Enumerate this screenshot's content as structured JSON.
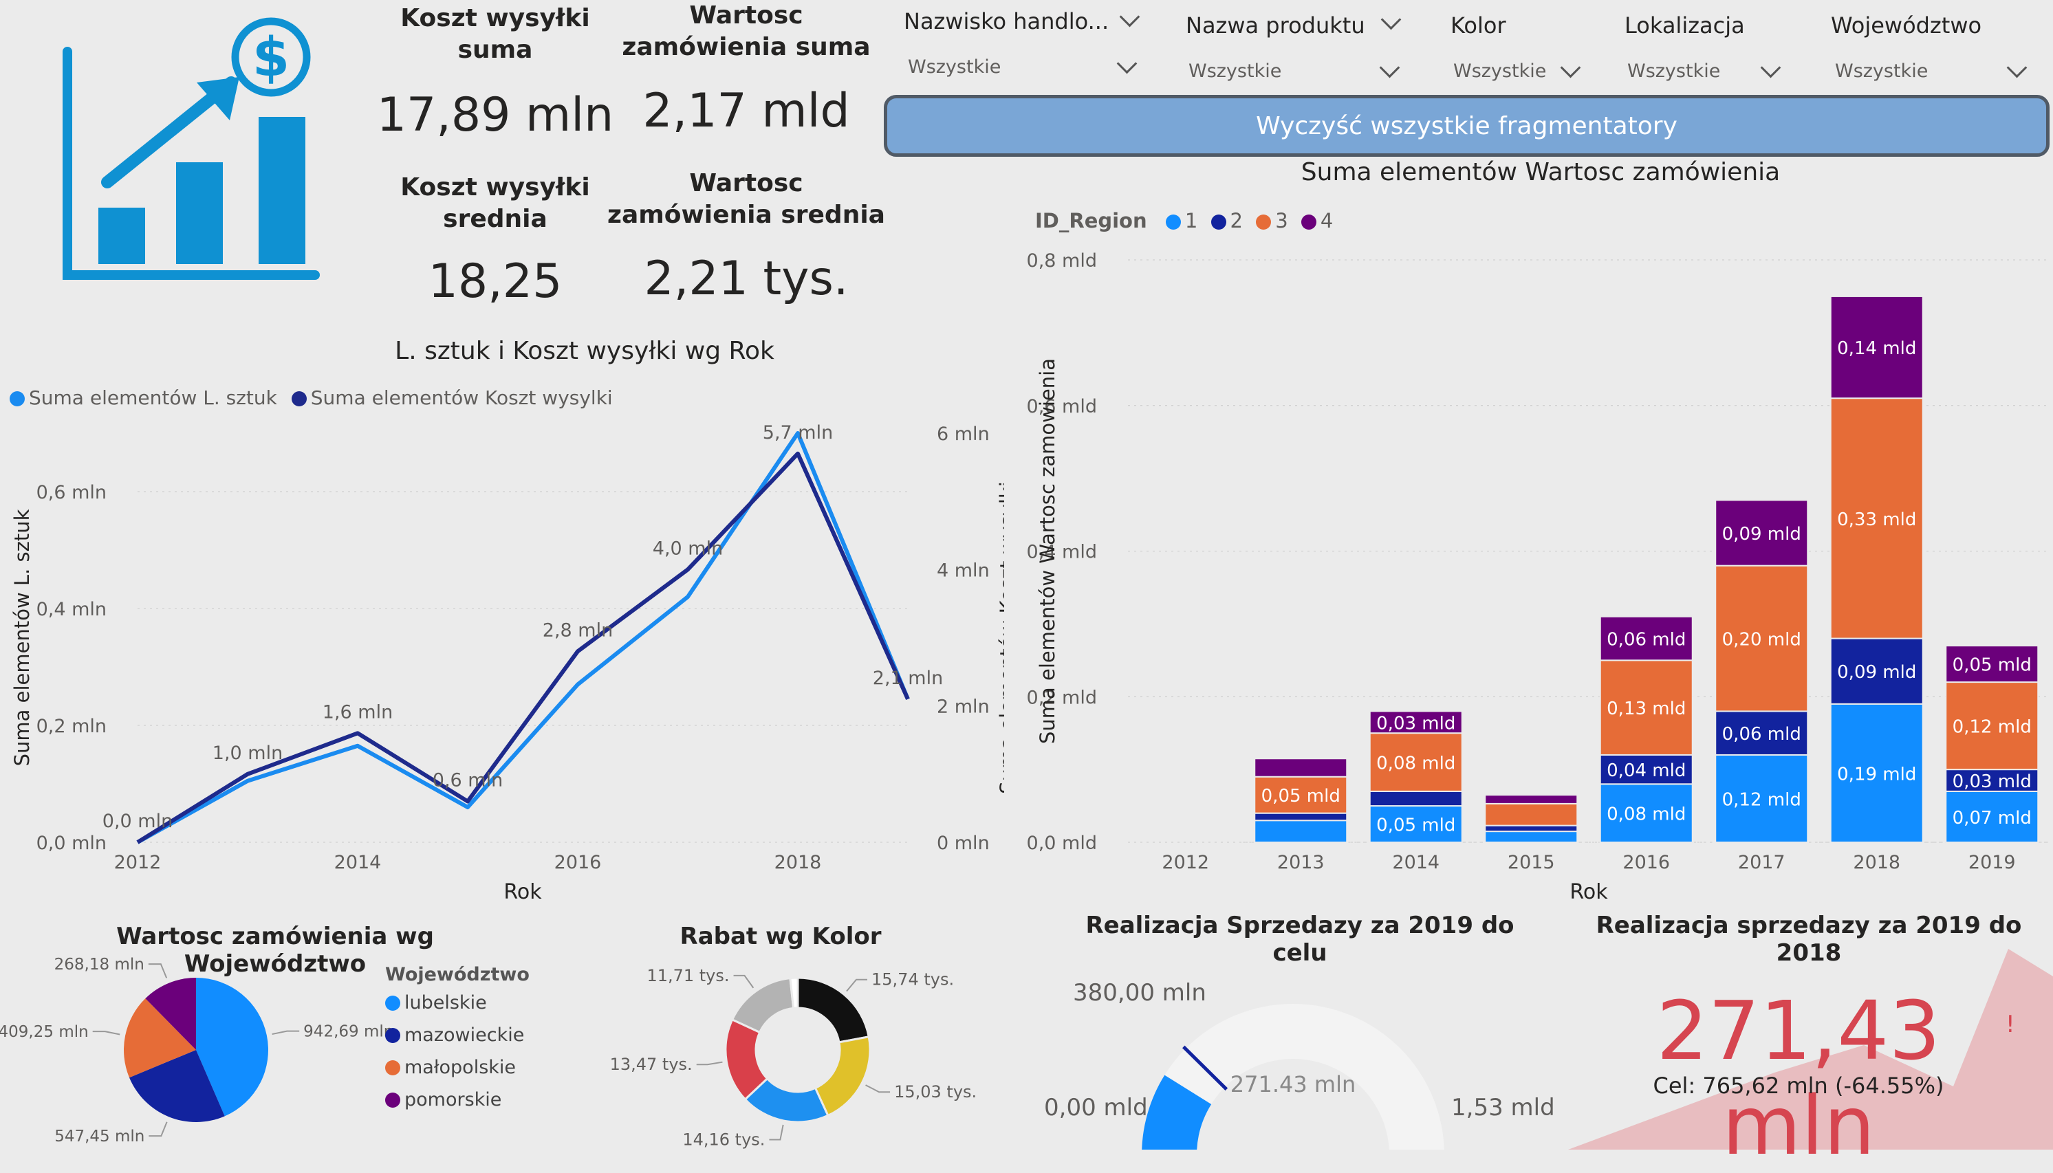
{
  "colors": {
    "region1": "#118dff",
    "region2": "#12239e",
    "region3": "#e66c37",
    "region4": "#6b007b",
    "line1": "#1a8bf0",
    "line2": "#1e2a8c",
    "accent_icon": "#0f91d2",
    "button": "#7aa6d6",
    "card_red": "#d64550"
  },
  "icons": {
    "logo": "growth-chart-dollar-icon"
  },
  "kpi": {
    "koszt_suma_label": "Koszt wysyłki suma",
    "koszt_suma_value": "17,89 mln",
    "wartosc_suma_label": "Wartosc zamówienia suma",
    "wartosc_suma_value": "2,17 mld",
    "koszt_srednia_label": "Koszt wysyłki srednia",
    "koszt_srednia_value": "18,25",
    "wartosc_srednia_label": "Wartosc zamówienia srednia",
    "wartosc_srednia_value": "2,21 tys."
  },
  "slicers": [
    {
      "title": "Nazwisko handlo...",
      "value": "Wszystkie"
    },
    {
      "title": "Nazwa produktu",
      "value": "Wszystkie"
    },
    {
      "title": "Kolor",
      "value": "Wszystkie"
    },
    {
      "title": "Lokalizacja",
      "value": "Wszystkie"
    },
    {
      "title": "Województwo",
      "value": "Wszystkie"
    }
  ],
  "clear_button": "Wyczyść wszystkie fragmentatory",
  "chart_data": [
    {
      "type": "line",
      "title": "L. sztuk i Koszt wysyłki wg Rok",
      "xlabel": "Rok",
      "ylabel": "Suma elementów L. sztuk",
      "ylabel2": "Suma elementów Koszt wysylki",
      "legend": [
        "Suma elementów L. sztuk",
        "Suma elementów Koszt wysylki"
      ],
      "x": [
        2012,
        2013,
        2014,
        2015,
        2016,
        2017,
        2018,
        2019
      ],
      "xticks": [
        "2012",
        "2014",
        "2016",
        "2018"
      ],
      "yticks": [
        "0,0 mln",
        "0,2 mln",
        "0,4 mln",
        "0,6 mln"
      ],
      "yticks2": [
        "0 mln",
        "2 mln",
        "4 mln",
        "6 mln"
      ],
      "ylim": [
        0,
        0.7
      ],
      "ylim2": [
        0,
        6
      ],
      "series": [
        {
          "name": "Suma elementów L. sztuk",
          "values": [
            0.0,
            0.105,
            0.165,
            0.06,
            0.27,
            0.42,
            0.7,
            0.245
          ]
        },
        {
          "name": "Suma elementów Koszt wysylki",
          "values": [
            0.0,
            1.0,
            1.6,
            0.6,
            2.8,
            4.0,
            5.7,
            2.1
          ]
        }
      ],
      "data_labels": [
        "0,0 mln",
        "1,0 mln",
        "1,6 mln",
        "0,6 mln",
        "2,8 mln",
        "4,0 mln",
        "5,7 mln",
        "2,1 mln"
      ]
    },
    {
      "type": "bar",
      "stacked": true,
      "title": "Suma elementów Wartosc zamówienia",
      "xlabel": "Rok",
      "ylabel": "Suma elementów Wartosc zamowienia",
      "legend_title": "ID_Region",
      "categories": [
        "2012",
        "2013",
        "2014",
        "2015",
        "2016",
        "2017",
        "2018",
        "2019"
      ],
      "yticks": [
        "0,0 mld",
        "0,2 mld",
        "0,4 mld",
        "0,6 mld",
        "0,8 mld"
      ],
      "ylim": [
        0,
        0.8
      ],
      "series": [
        {
          "name": "1",
          "values": [
            0,
            0.03,
            0.05,
            0.015,
            0.08,
            0.12,
            0.19,
            0.07
          ],
          "labels": [
            "",
            "",
            "0,05 mld",
            "",
            "0,08 mld",
            "0,12 mld",
            "0,19 mld",
            "0,07 mld"
          ]
        },
        {
          "name": "2",
          "values": [
            0,
            0.01,
            0.02,
            0.008,
            0.04,
            0.06,
            0.09,
            0.03
          ],
          "labels": [
            "",
            "",
            "",
            "",
            "0,04 mld",
            "0,06 mld",
            "0,09 mld",
            "0,03 mld"
          ]
        },
        {
          "name": "3",
          "values": [
            0,
            0.05,
            0.08,
            0.03,
            0.13,
            0.2,
            0.33,
            0.12
          ],
          "labels": [
            "",
            "0,05 mld",
            "0,08 mld",
            "",
            "0,13 mld",
            "0,20 mld",
            "0,33 mld",
            "0,12 mld"
          ]
        },
        {
          "name": "4",
          "values": [
            0,
            0.025,
            0.03,
            0.012,
            0.06,
            0.09,
            0.14,
            0.05
          ],
          "labels": [
            "",
            "",
            "0,03 mld",
            "",
            "0,06 mld",
            "0,09 mld",
            "0,14 mld",
            "0,05 mld"
          ]
        }
      ]
    },
    {
      "type": "pie",
      "title": "Wartosc zamówienia wg Województwo",
      "legend_title": "Województwo",
      "categories": [
        "lubelskie",
        "mazowieckie",
        "małopolskie",
        "pomorskie"
      ],
      "values": [
        942.69,
        547.45,
        409.25,
        268.18
      ],
      "labels": [
        "942,69 mln",
        "547,45 mln",
        "409,25 mln",
        "268,18 mln"
      ]
    },
    {
      "type": "pie",
      "donut": true,
      "title": "Rabat wg Kolor",
      "values": [
        15.74,
        15.03,
        14.16,
        13.47,
        11.71,
        1.2
      ],
      "colors": [
        "#111111",
        "#e0c12a",
        "#1e90f0",
        "#d9404a",
        "#b3b3b3",
        "#ffffff"
      ],
      "labels": [
        "15,74 tys.",
        "15,03 tys.",
        "14,16 tys.",
        "13,47 tys.",
        "11,71 tys.",
        ""
      ]
    }
  ],
  "gauge": {
    "title": "Realizacja Sprzedazy za 2019 do celu",
    "value_label": "271.43 mln",
    "min_label": "0,00 mld",
    "max_label": "1,53 mld",
    "target_label": "380,00 mln",
    "value": 0.27143,
    "min": 0,
    "max": 1.53,
    "target": 0.38
  },
  "card": {
    "title": "Realizacja sprzedazy za 2019 do 2018",
    "value": "271,43 mln",
    "mark": "!",
    "subtitle": "Cel: 765,62 mln (-64.55%)"
  }
}
